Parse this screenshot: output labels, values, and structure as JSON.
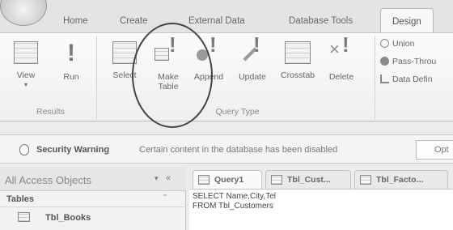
{
  "ribbon_tabs": [
    "Home",
    "Create",
    "External Data",
    "Database Tools",
    "Design"
  ],
  "active_tab": "Design",
  "groups": {
    "results": {
      "label": "Results",
      "buttons": {
        "view": "View",
        "run": "Run"
      }
    },
    "query_type": {
      "label": "Query Type",
      "buttons": {
        "select": "Select",
        "make_table_1": "Make",
        "make_table_2": "Table",
        "append": "Append",
        "update": "Update",
        "crosstab": "Crosstab",
        "delete": "Delete"
      },
      "small_items": [
        "Union",
        "Pass-Throu",
        "Data Defin"
      ]
    }
  },
  "security_bar": {
    "title": "Security Warning",
    "message": "Certain content in the database has been disabled",
    "options_button": "Opt"
  },
  "nav_pane": {
    "title": "All Access Objects",
    "section": "Tables",
    "items": [
      "Tbl_Books"
    ]
  },
  "doc_tabs": [
    "Query1",
    "Tbl_Cust...",
    "Tbl_Facto..."
  ],
  "sql_lines": [
    "SELECT Name,City,Tel",
    "FROM Tbl_Customers"
  ],
  "icons": {
    "view": "datasheet-view-icon",
    "run": "exclamation-run-icon",
    "shield": "security-shield-icon"
  }
}
